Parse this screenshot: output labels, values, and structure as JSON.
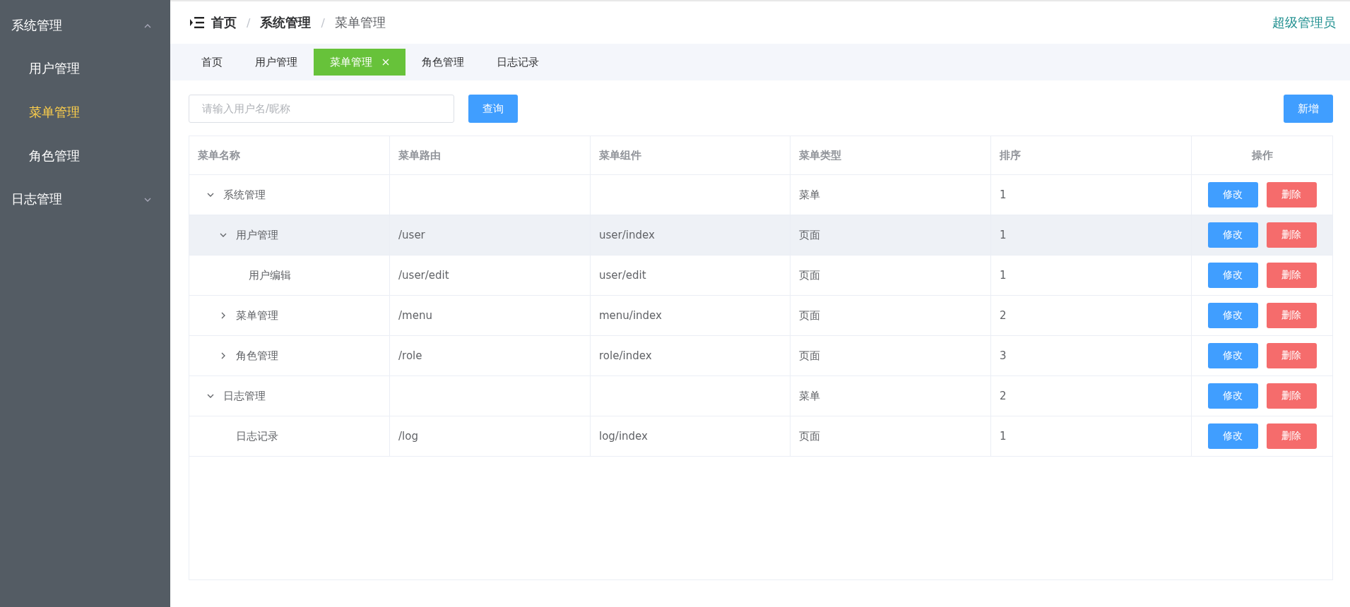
{
  "sidebar": {
    "groups": [
      {
        "label": "系统管理",
        "expanded": true,
        "items": [
          {
            "label": "用户管理",
            "selected": false
          },
          {
            "label": "菜单管理",
            "selected": true
          },
          {
            "label": "角色管理",
            "selected": false
          }
        ]
      },
      {
        "label": "日志管理",
        "expanded": false
      }
    ]
  },
  "breadcrumb_separator": "/",
  "breadcrumb": [
    {
      "label": "首页",
      "current": false
    },
    {
      "label": "系统管理",
      "current": false
    },
    {
      "label": "菜单管理",
      "current": true
    }
  ],
  "user": "超级管理员",
  "tabs": [
    {
      "label": "首页",
      "selected": false
    },
    {
      "label": "用户管理",
      "selected": false
    },
    {
      "label": "菜单管理",
      "selected": true
    },
    {
      "label": "角色管理",
      "selected": false
    },
    {
      "label": "日志记录",
      "selected": false
    }
  ],
  "search": {
    "placeholder": "请输入用户名/昵称",
    "button": "查询"
  },
  "add_button": "新增",
  "table": {
    "columns": [
      "菜单名称",
      "菜单路由",
      "菜单组件",
      "菜单类型",
      "排序",
      "操作"
    ],
    "rows": [
      {
        "name": "系统管理",
        "route": "",
        "component": "",
        "type": "菜单",
        "order": "1",
        "highlighted": false,
        "expanded": true,
        "actions": [
          "修改",
          "删除"
        ],
        "children": [
          {
            "name": "用户管理",
            "route": "/user",
            "component": "user/index",
            "type": "页面",
            "order": "1",
            "highlighted": true,
            "expanded": true,
            "actions": [
              "修改",
              "删除"
            ],
            "children": [
              {
                "name": "用户编辑",
                "route": "/user/edit",
                "component": "user/edit",
                "type": "页面",
                "order": "1",
                "highlighted": false,
                "actions": [
                  "修改",
                  "删除"
                ]
              }
            ]
          },
          {
            "name": "菜单管理",
            "route": "/menu",
            "component": "menu/index",
            "type": "页面",
            "order": "2",
            "highlighted": false,
            "expanded": false,
            "actions": [
              "修改",
              "删除"
            ]
          },
          {
            "name": "角色管理",
            "route": "/role",
            "component": "role/index",
            "type": "页面",
            "order": "3",
            "highlighted": false,
            "expanded": false,
            "actions": [
              "修改",
              "删除"
            ]
          }
        ]
      },
      {
        "name": "日志管理",
        "route": "",
        "component": "",
        "type": "菜单",
        "order": "2",
        "highlighted": false,
        "expanded": true,
        "actions": [
          "修改",
          "删除"
        ],
        "children": [
          {
            "name": "日志记录",
            "route": "/log",
            "component": "log/index",
            "type": "页面",
            "order": "1",
            "highlighted": false,
            "actions": [
              "修改",
              "删除"
            ]
          }
        ]
      }
    ]
  }
}
